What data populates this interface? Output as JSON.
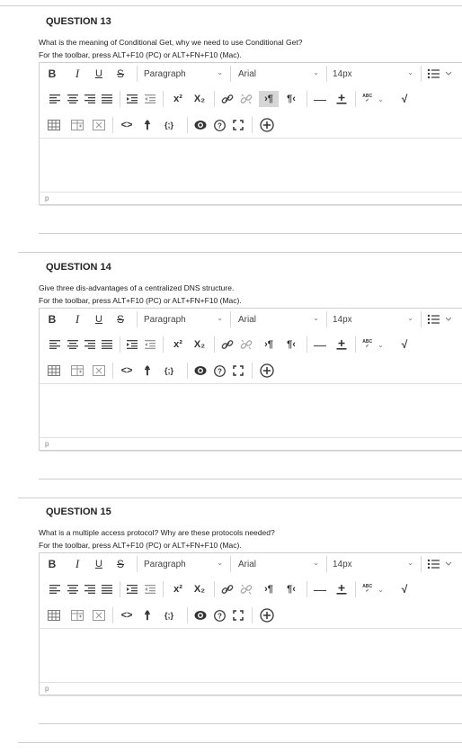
{
  "questions": [
    {
      "title": "QUESTION 13",
      "text": "What is the meaning of Conditional Get, why we need to use Conditional Get?",
      "help": "For the toolbar, press ALT+F10 (PC) or ALT+FN+F10 (Mac).",
      "format": "Paragraph",
      "font": "Arial",
      "size": "14px",
      "status_path": "p",
      "ltr_active": true
    },
    {
      "title": "QUESTION 14",
      "text": "Give three dis-advantages of a centralized DNS structure.",
      "help": "For the toolbar, press ALT+F10 (PC) or ALT+FN+F10 (Mac).",
      "format": "Paragraph",
      "font": "Arial",
      "size": "14px",
      "status_path": "p",
      "ltr_active": false
    },
    {
      "title": "QUESTION 15",
      "text": "What is a multiple access protocol? Why are these protocols needed?",
      "help": "For the toolbar, press ALT+F10 (PC) or ALT+FN+F10 (Mac).",
      "format": "Paragraph",
      "font": "Arial",
      "size": "14px",
      "status_path": "p",
      "ltr_active": false
    }
  ],
  "toolbar_glyphs": {
    "bold": "B",
    "italic": "I",
    "underline": "U",
    "strike": "S",
    "superscript": "x²",
    "subscript": "X₂",
    "code": "<>",
    "html_source": "{;}",
    "spellcheck": "ABC"
  }
}
